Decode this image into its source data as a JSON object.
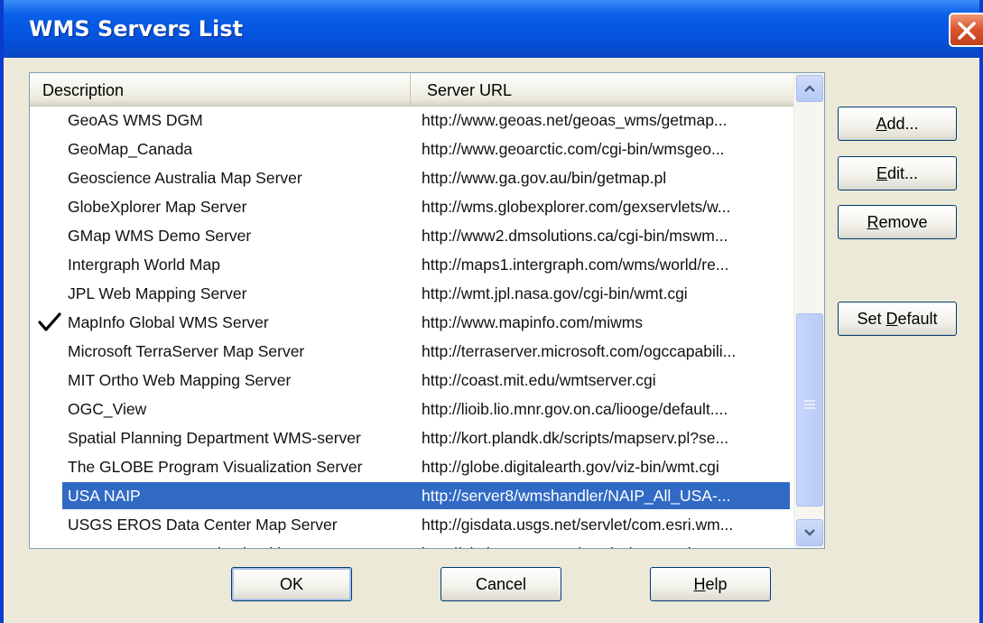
{
  "window": {
    "title": "WMS Servers List"
  },
  "listview": {
    "columns": {
      "description": "Description",
      "url": "Server URL"
    },
    "rows": [
      {
        "description": "GeoAS WMS DGM",
        "url": "http://www.geoas.net/geoas_wms/getmap..."
      },
      {
        "description": "GeoMap_Canada",
        "url": "http://www.geoarctic.com/cgi-bin/wmsgeo..."
      },
      {
        "description": "Geoscience Australia Map Server",
        "url": "http://www.ga.gov.au/bin/getmap.pl"
      },
      {
        "description": "GlobeXplorer Map Server",
        "url": "http://wms.globexplorer.com/gexservlets/w..."
      },
      {
        "description": "GMap WMS Demo Server",
        "url": "http://www2.dmsolutions.ca/cgi-bin/mswm..."
      },
      {
        "description": "Intergraph World Map",
        "url": "http://maps1.intergraph.com/wms/world/re..."
      },
      {
        "description": "JPL Web Mapping Server",
        "url": "http://wmt.jpl.nasa.gov/cgi-bin/wmt.cgi"
      },
      {
        "description": "MapInfo Global WMS Server",
        "url": "http://www.mapinfo.com/miwms",
        "default": true
      },
      {
        "description": "Microsoft TerraServer Map Server",
        "url": "http://terraserver.microsoft.com/ogccapabili..."
      },
      {
        "description": "MIT Ortho Web Mapping Server",
        "url": "http://coast.mit.edu/wmtserver.cgi"
      },
      {
        "description": "OGC_View",
        "url": "http://lioib.lio.mnr.gov.on.ca/liooge/default...."
      },
      {
        "description": "Spatial Planning Department WMS-server",
        "url": "http://kort.plandk.dk/scripts/mapserv.pl?se..."
      },
      {
        "description": "The GLOBE Program Visualization Server",
        "url": "http://globe.digitalearth.gov/viz-bin/wmt.cgi"
      },
      {
        "description": "USA NAIP",
        "url": "http://server8/wmshandler/NAIP_All_USA-...",
        "selected": true
      },
      {
        "description": "USGS EROS Data Center Map Server",
        "url": "http://gisdata.usgs.net/servlet/com.esri.wm..."
      },
      {
        "description": "WMT Map Server maintained by USGS E...",
        "url": "http://gisdata.usgs.net/servlet/com.esri.wm..."
      }
    ],
    "scroll_position": 0.72
  },
  "side_buttons": {
    "add": {
      "accel": "A",
      "rest": "dd..."
    },
    "edit": {
      "accel": "E",
      "rest": "dit..."
    },
    "remove": {
      "accel": "R",
      "rest": "emove"
    },
    "set_default": {
      "pre": "Set ",
      "accel": "D",
      "rest": "efault"
    }
  },
  "bottom_buttons": {
    "ok": "OK",
    "cancel": "Cancel",
    "help": {
      "accel": "H",
      "rest": "elp"
    }
  },
  "colors": {
    "selection": "#316ac5",
    "titlebar": "#0454e0"
  },
  "icons": {
    "close": "close-icon",
    "check": "checkmark-icon",
    "up": "scroll-up-arrow-icon",
    "down": "scroll-down-arrow-icon"
  }
}
